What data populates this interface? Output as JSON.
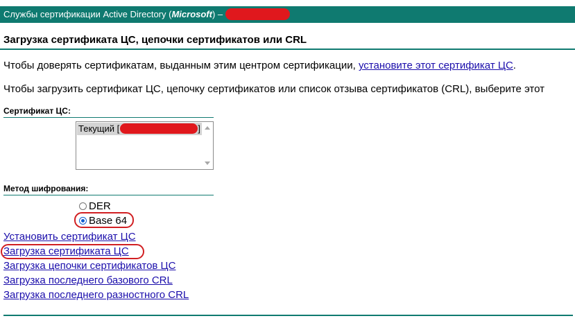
{
  "header": {
    "title_prefix": "Службы сертификации Active Directory (",
    "brand": "Microsoft",
    "title_suffix": ")  –"
  },
  "page": {
    "title": "Загрузка сертификата ЦС, цепочки сертификатов или CRL",
    "trust_text": "Чтобы доверять сертификатам, выданным этим центром сертификации, ",
    "trust_link": "установите этот сертификат ЦС",
    "trust_end": ".",
    "download_text": "Чтобы загрузить сертификат ЦС, цепочку сертификатов или список отзыва сертификатов (CRL), выберите этот"
  },
  "ca_cert": {
    "label": "Сертификат ЦС:",
    "option_prefix": "Текущий [",
    "option_suffix": "]"
  },
  "encoding": {
    "label": "Метод шифрования:",
    "options": [
      {
        "label": "DER",
        "selected": false
      },
      {
        "label": "Base 64",
        "selected": true
      }
    ]
  },
  "links": [
    "Установить сертификат ЦС",
    "Загрузка сертификата ЦС",
    "Загрузка цепочки сертификатов ЦС",
    "Загрузка последнего базового CRL",
    "Загрузка последнего разностного CRL"
  ],
  "colors": {
    "header_bg": "#0f7a70",
    "link": "#1a0dab",
    "annotation": "#d11f22",
    "redaction": "#e0181d"
  }
}
